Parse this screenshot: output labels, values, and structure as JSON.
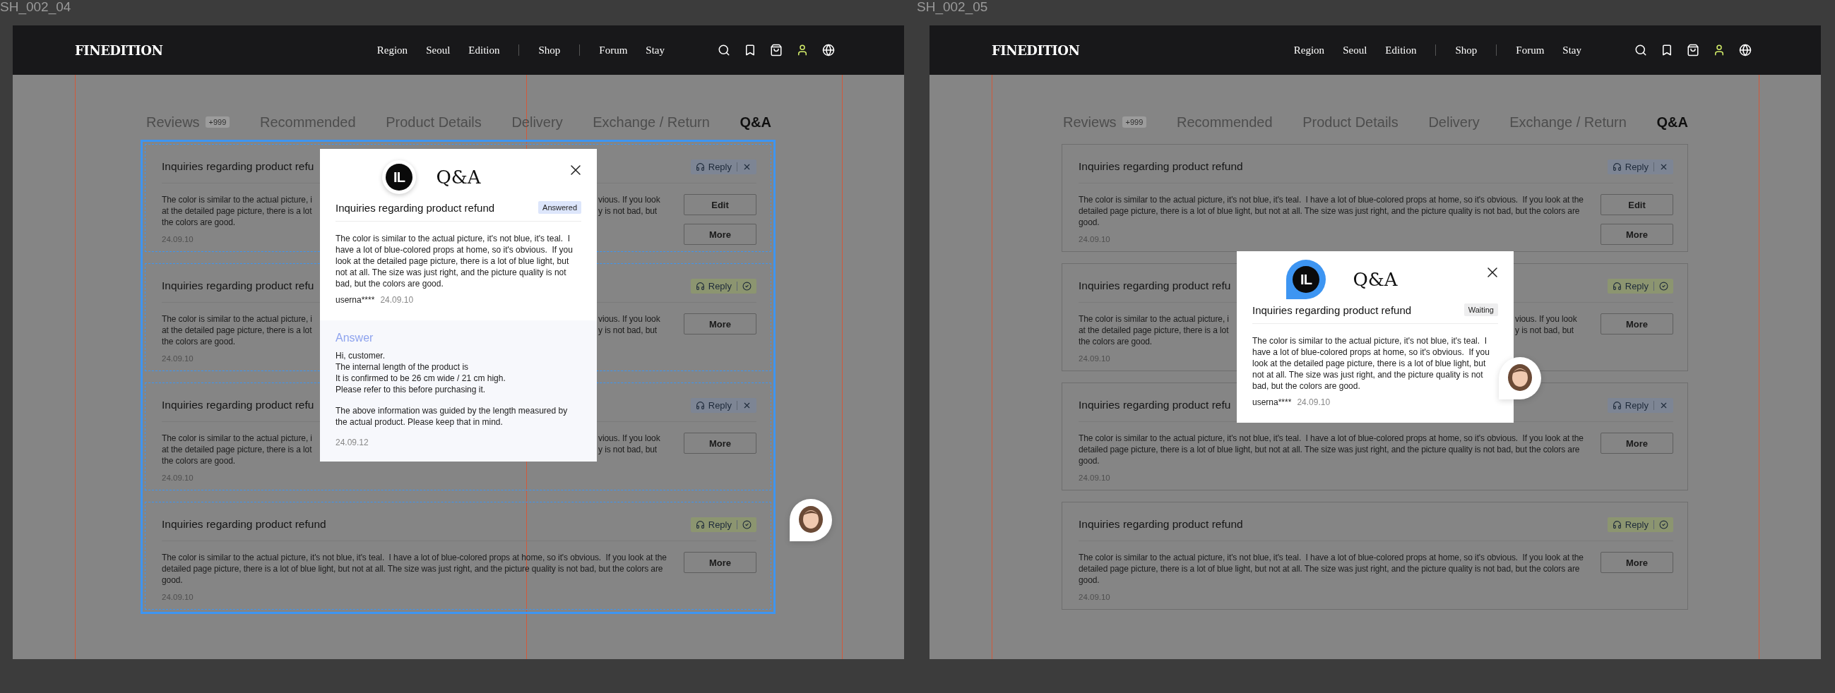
{
  "frames": [
    {
      "label": "SH_002_04",
      "selected": true,
      "header": {
        "logo": "FINEDITION",
        "nav_groups": [
          [
            "Region",
            "Seoul",
            "Edition"
          ],
          [
            "Shop"
          ],
          [
            "Forum",
            "Stay"
          ]
        ]
      },
      "tabs": [
        {
          "label": "Reviews",
          "badge": "+999",
          "selected": false
        },
        {
          "label": "Recommended",
          "selected": false
        },
        {
          "label": "Product Details",
          "selected": false
        },
        {
          "label": "Delivery",
          "selected": false
        },
        {
          "label": "Exchange / Return",
          "selected": false
        },
        {
          "label": "Q&A",
          "selected": true
        }
      ],
      "cards": [
        {
          "title": "Inquiries regarding product refu",
          "answered": false,
          "reply_label": "Reply",
          "body_lines": [
            {
              "left": "The color is similar to the actual picture, i",
              "right": "vious.  If you look"
            },
            {
              "left": "at the detailed page picture, there is a lot",
              "right": "y is not bad, but"
            },
            {
              "left": "the colors are good."
            }
          ],
          "date": "24.09.10",
          "buttons": [
            "Edit",
            "More"
          ]
        },
        {
          "title": "Inquiries regarding product refu",
          "answered": true,
          "reply_label": "Reply",
          "body_lines": [
            {
              "left": "The color is similar to the actual picture, i",
              "right": "vious.  If you look"
            },
            {
              "left": "at the detailed page picture, there is a lot",
              "right": "y is not bad, but"
            },
            {
              "left": "the colors are good."
            }
          ],
          "date": "24.09.10",
          "buttons": [
            "More"
          ]
        },
        {
          "title": "Inquiries regarding product refu",
          "answered": false,
          "reply_label": "Reply",
          "body_lines": [
            {
              "left": "The color is similar to the actual picture, i",
              "right": "vious.  If you look"
            },
            {
              "left": "at the detailed page picture, there is a lot",
              "right": "y is not bad, but"
            },
            {
              "left": "the colors are good."
            }
          ],
          "date": "24.09.10",
          "buttons": [
            "More"
          ]
        },
        {
          "title": "Inquiries regarding product refund",
          "answered": true,
          "reply_label": "Reply",
          "body": "The color is similar to the actual picture, it's not blue, it's teal.  I have a lot of blue-colored props at home, so it's obvious.  If you look at the detailed page picture, there is a lot of blue light, but not at all. The size was just right, and the picture quality is not bad, but the colors are good.",
          "date": "24.09.10",
          "buttons": [
            "More"
          ]
        }
      ],
      "modal": {
        "title": "Q&A",
        "cursor": {
          "initials": "IL",
          "kind": "dot"
        },
        "question": {
          "title": "Inquiries regarding product refund",
          "answered": true,
          "status_label": "Answered",
          "body": "The color is similar to the actual picture, it's not blue, it's teal.  I have a lot of blue-colored props at home, so it's obvious.  If you look at the detailed page picture, there is a lot of blue light, but not at all. The size was just right, and the picture quality is not bad, but the colors are good.",
          "user": "userna****",
          "date": "24.09.10"
        },
        "answer": {
          "heading": "Answer",
          "paragraphs": [
            [
              "Hi, customer.",
              "The internal length of the product is",
              "It is confirmed to be 26 cm wide / 21 cm high.",
              "Please refer to this before purchasing it."
            ],
            [
              "The above information was guided by the length measured by the actual product. Please keep that in mind."
            ]
          ],
          "date": "24.09.12"
        }
      },
      "comment_avatar": {
        "on_dialog": false
      }
    },
    {
      "label": "SH_002_05",
      "selected": false,
      "header": {
        "logo": "FINEDITION",
        "nav_groups": [
          [
            "Region",
            "Seoul",
            "Edition"
          ],
          [
            "Shop"
          ],
          [
            "Forum",
            "Stay"
          ]
        ]
      },
      "tabs": [
        {
          "label": "Reviews",
          "badge": "+999",
          "selected": false
        },
        {
          "label": "Recommended",
          "selected": false
        },
        {
          "label": "Product Details",
          "selected": false
        },
        {
          "label": "Delivery",
          "selected": false
        },
        {
          "label": "Exchange / Return",
          "selected": false
        },
        {
          "label": "Q&A",
          "selected": true
        }
      ],
      "cards": [
        {
          "title": "Inquiries regarding product refund",
          "answered": false,
          "reply_label": "Reply",
          "body": "The color is similar to the actual picture, it's not blue, it's teal.  I have a lot of blue-colored props at home, so it's obvious.  If you look at the detailed page picture, there is a lot of blue light, but not at all. The size was just right, and the picture quality is not bad, but the colors are good.",
          "date": "24.09.10",
          "buttons": [
            "Edit",
            "More"
          ]
        },
        {
          "title": "Inquiries regarding product refu",
          "answered": true,
          "reply_label": "Reply",
          "body_lines": [
            {
              "left": "The color is similar to the actual picture, i",
              "right": "vious.  If you look"
            },
            {
              "left": "at the detailed page picture, there is a lot",
              "right": "y is not bad, but"
            },
            {
              "left": "the colors are good."
            }
          ],
          "date": "24.09.10",
          "buttons": [
            "More"
          ]
        },
        {
          "title": "Inquiries regarding product refu",
          "answered": false,
          "reply_label": "Reply",
          "body": "The color is similar to the actual picture, it's not blue, it's teal.  I have a lot of blue-colored props at home, so it's obvious.  If you look at the detailed page picture, there is a lot of blue light, but not at all. The size was just right, and the picture quality is not bad, but the colors are good.",
          "date": "24.09.10",
          "buttons": [
            "More"
          ]
        },
        {
          "title": "Inquiries regarding product refund",
          "answered": true,
          "reply_label": "Reply",
          "body": "The color is similar to the actual picture, it's not blue, it's teal.  I have a lot of blue-colored props at home, so it's obvious.  If you look at the detailed page picture, there is a lot of blue light, but not at all. The size was just right, and the picture quality is not bad, but the colors are good.",
          "date": "24.09.10",
          "buttons": [
            "More"
          ]
        }
      ],
      "modal": {
        "title": "Q&A",
        "cursor": {
          "initials": "IL",
          "kind": "pin"
        },
        "question": {
          "title": "Inquiries regarding product refund",
          "answered": false,
          "status_label": "Waiting",
          "body": "The color is similar to the actual picture, it's not blue, it's teal.  I have a lot of blue-colored props at home, so it's obvious.  If you look at the detailed page picture, there is a lot of blue light, but not at all. The size was just right, and the picture quality is not bad, but the colors are good.",
          "user": "userna****",
          "date": "24.09.10"
        }
      },
      "comment_avatar": {
        "on_dialog": true
      }
    }
  ]
}
